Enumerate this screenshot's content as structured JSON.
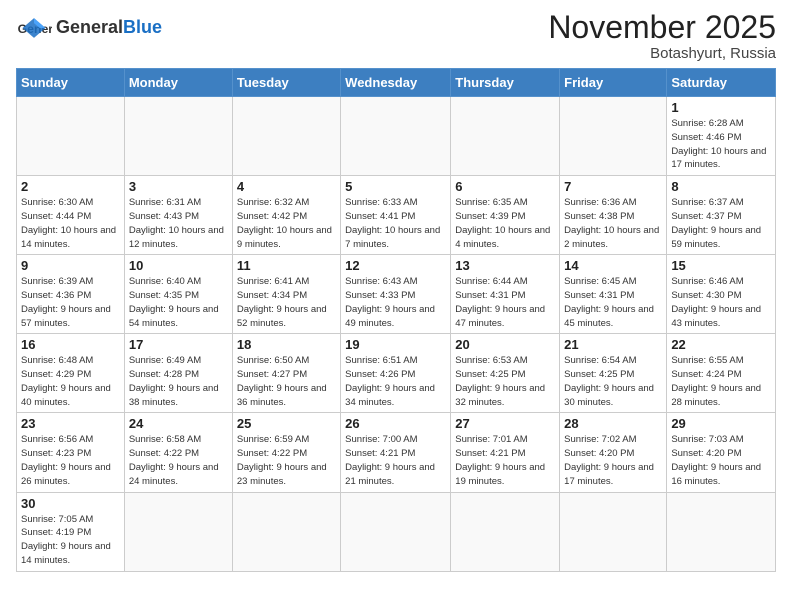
{
  "header": {
    "logo_general": "General",
    "logo_blue": "Blue",
    "month_title": "November 2025",
    "subtitle": "Botashyurt, Russia"
  },
  "weekdays": [
    "Sunday",
    "Monday",
    "Tuesday",
    "Wednesday",
    "Thursday",
    "Friday",
    "Saturday"
  ],
  "weeks": [
    [
      {
        "day": "",
        "info": ""
      },
      {
        "day": "",
        "info": ""
      },
      {
        "day": "",
        "info": ""
      },
      {
        "day": "",
        "info": ""
      },
      {
        "day": "",
        "info": ""
      },
      {
        "day": "",
        "info": ""
      },
      {
        "day": "1",
        "info": "Sunrise: 6:28 AM\nSunset: 4:46 PM\nDaylight: 10 hours\nand 17 minutes."
      }
    ],
    [
      {
        "day": "2",
        "info": "Sunrise: 6:30 AM\nSunset: 4:44 PM\nDaylight: 10 hours\nand 14 minutes."
      },
      {
        "day": "3",
        "info": "Sunrise: 6:31 AM\nSunset: 4:43 PM\nDaylight: 10 hours\nand 12 minutes."
      },
      {
        "day": "4",
        "info": "Sunrise: 6:32 AM\nSunset: 4:42 PM\nDaylight: 10 hours\nand 9 minutes."
      },
      {
        "day": "5",
        "info": "Sunrise: 6:33 AM\nSunset: 4:41 PM\nDaylight: 10 hours\nand 7 minutes."
      },
      {
        "day": "6",
        "info": "Sunrise: 6:35 AM\nSunset: 4:39 PM\nDaylight: 10 hours\nand 4 minutes."
      },
      {
        "day": "7",
        "info": "Sunrise: 6:36 AM\nSunset: 4:38 PM\nDaylight: 10 hours\nand 2 minutes."
      },
      {
        "day": "8",
        "info": "Sunrise: 6:37 AM\nSunset: 4:37 PM\nDaylight: 9 hours\nand 59 minutes."
      }
    ],
    [
      {
        "day": "9",
        "info": "Sunrise: 6:39 AM\nSunset: 4:36 PM\nDaylight: 9 hours\nand 57 minutes."
      },
      {
        "day": "10",
        "info": "Sunrise: 6:40 AM\nSunset: 4:35 PM\nDaylight: 9 hours\nand 54 minutes."
      },
      {
        "day": "11",
        "info": "Sunrise: 6:41 AM\nSunset: 4:34 PM\nDaylight: 9 hours\nand 52 minutes."
      },
      {
        "day": "12",
        "info": "Sunrise: 6:43 AM\nSunset: 4:33 PM\nDaylight: 9 hours\nand 49 minutes."
      },
      {
        "day": "13",
        "info": "Sunrise: 6:44 AM\nSunset: 4:31 PM\nDaylight: 9 hours\nand 47 minutes."
      },
      {
        "day": "14",
        "info": "Sunrise: 6:45 AM\nSunset: 4:31 PM\nDaylight: 9 hours\nand 45 minutes."
      },
      {
        "day": "15",
        "info": "Sunrise: 6:46 AM\nSunset: 4:30 PM\nDaylight: 9 hours\nand 43 minutes."
      }
    ],
    [
      {
        "day": "16",
        "info": "Sunrise: 6:48 AM\nSunset: 4:29 PM\nDaylight: 9 hours\nand 40 minutes."
      },
      {
        "day": "17",
        "info": "Sunrise: 6:49 AM\nSunset: 4:28 PM\nDaylight: 9 hours\nand 38 minutes."
      },
      {
        "day": "18",
        "info": "Sunrise: 6:50 AM\nSunset: 4:27 PM\nDaylight: 9 hours\nand 36 minutes."
      },
      {
        "day": "19",
        "info": "Sunrise: 6:51 AM\nSunset: 4:26 PM\nDaylight: 9 hours\nand 34 minutes."
      },
      {
        "day": "20",
        "info": "Sunrise: 6:53 AM\nSunset: 4:25 PM\nDaylight: 9 hours\nand 32 minutes."
      },
      {
        "day": "21",
        "info": "Sunrise: 6:54 AM\nSunset: 4:25 PM\nDaylight: 9 hours\nand 30 minutes."
      },
      {
        "day": "22",
        "info": "Sunrise: 6:55 AM\nSunset: 4:24 PM\nDaylight: 9 hours\nand 28 minutes."
      }
    ],
    [
      {
        "day": "23",
        "info": "Sunrise: 6:56 AM\nSunset: 4:23 PM\nDaylight: 9 hours\nand 26 minutes."
      },
      {
        "day": "24",
        "info": "Sunrise: 6:58 AM\nSunset: 4:22 PM\nDaylight: 9 hours\nand 24 minutes."
      },
      {
        "day": "25",
        "info": "Sunrise: 6:59 AM\nSunset: 4:22 PM\nDaylight: 9 hours\nand 23 minutes."
      },
      {
        "day": "26",
        "info": "Sunrise: 7:00 AM\nSunset: 4:21 PM\nDaylight: 9 hours\nand 21 minutes."
      },
      {
        "day": "27",
        "info": "Sunrise: 7:01 AM\nSunset: 4:21 PM\nDaylight: 9 hours\nand 19 minutes."
      },
      {
        "day": "28",
        "info": "Sunrise: 7:02 AM\nSunset: 4:20 PM\nDaylight: 9 hours\nand 17 minutes."
      },
      {
        "day": "29",
        "info": "Sunrise: 7:03 AM\nSunset: 4:20 PM\nDaylight: 9 hours\nand 16 minutes."
      }
    ],
    [
      {
        "day": "30",
        "info": "Sunrise: 7:05 AM\nSunset: 4:19 PM\nDaylight: 9 hours\nand 14 minutes."
      },
      {
        "day": "",
        "info": ""
      },
      {
        "day": "",
        "info": ""
      },
      {
        "day": "",
        "info": ""
      },
      {
        "day": "",
        "info": ""
      },
      {
        "day": "",
        "info": ""
      },
      {
        "day": "",
        "info": ""
      }
    ]
  ]
}
